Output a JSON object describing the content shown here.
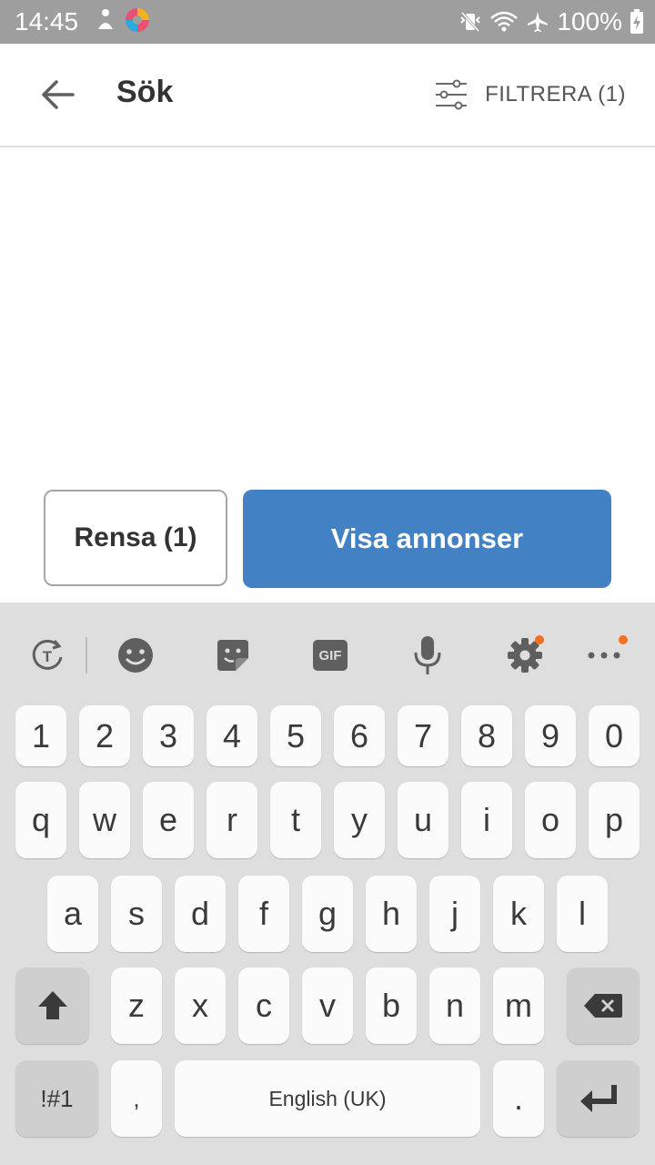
{
  "status_bar": {
    "time": "14:45",
    "battery": "100%",
    "icons": [
      "notification-figure-icon",
      "browser-app-icon",
      "vibrate-icon",
      "wifi-icon",
      "airplane-icon",
      "battery-charging-icon"
    ]
  },
  "app_bar": {
    "title": "Sök",
    "filter_label": "FILTRERA (1)",
    "back_icon": "arrow-left-icon",
    "filter_icon": "sliders-icon"
  },
  "actions": {
    "clear_label": "Rensa (1)",
    "show_label": "Visa annonser",
    "show_color": "#4181c4"
  },
  "keyboard": {
    "toolbar": [
      "translate-icon",
      "emoji-icon",
      "sticker-icon",
      "gif-icon",
      "microphone-icon",
      "settings-icon",
      "more-icon"
    ],
    "gif_label": "GIF",
    "row_numbers": [
      "1",
      "2",
      "3",
      "4",
      "5",
      "6",
      "7",
      "8",
      "9",
      "0"
    ],
    "row_top": [
      "q",
      "w",
      "e",
      "r",
      "t",
      "y",
      "u",
      "i",
      "o",
      "p"
    ],
    "row_middle": [
      "a",
      "s",
      "d",
      "f",
      "g",
      "h",
      "j",
      "k",
      "l"
    ],
    "row_bottom": [
      "z",
      "x",
      "c",
      "v",
      "b",
      "n",
      "m"
    ],
    "symbols_label": "!#1",
    "comma_label": ",",
    "space_label": "English (UK)",
    "period_label": ".",
    "accent_dot_color": "#f36f21"
  }
}
